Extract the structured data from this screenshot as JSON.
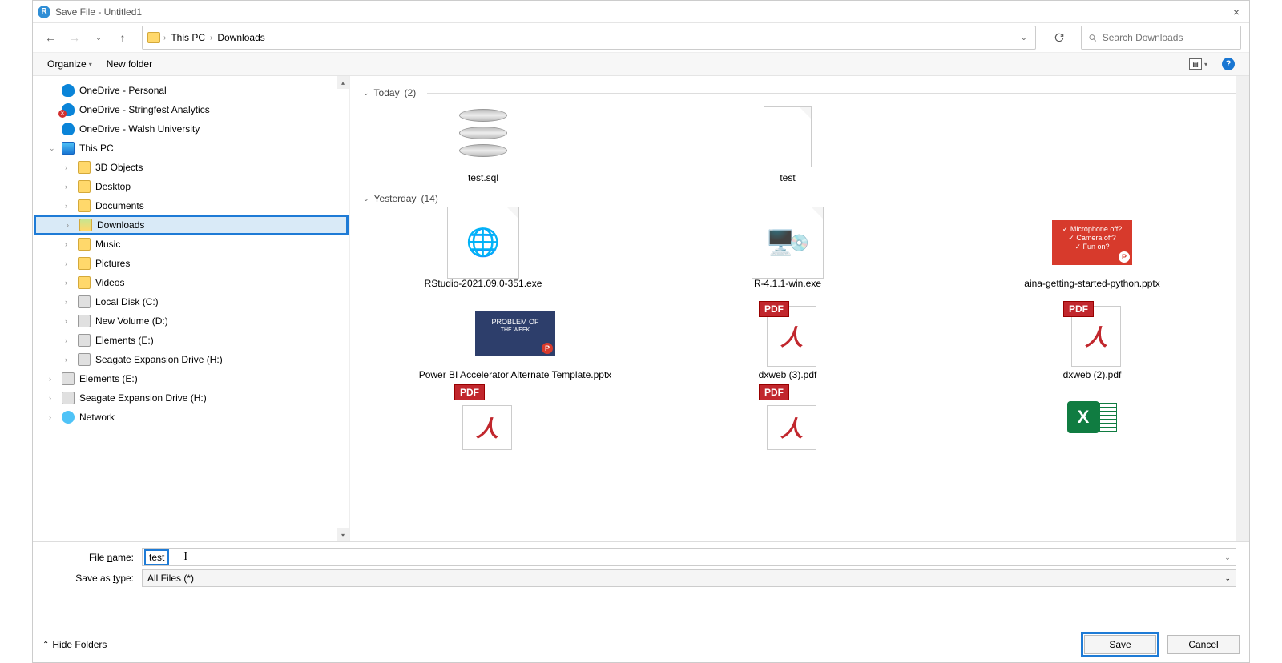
{
  "window": {
    "title": "Save File - Untitled1"
  },
  "nav": {
    "crumb1": "This PC",
    "crumb2": "Downloads",
    "search_placeholder": "Search Downloads"
  },
  "toolbar": {
    "organize": "Organize",
    "new_folder": "New folder"
  },
  "sidebar": {
    "items": [
      {
        "label": "OneDrive - Personal",
        "icon": "cloud",
        "chev": ""
      },
      {
        "label": "OneDrive - Stringfest Analytics",
        "icon": "cloud-err",
        "chev": ""
      },
      {
        "label": "OneDrive - Walsh University",
        "icon": "cloud",
        "chev": ""
      },
      {
        "label": "This PC",
        "icon": "pc",
        "chev": "v"
      },
      {
        "label": "3D Objects",
        "icon": "folder",
        "chev": ">",
        "indent": true
      },
      {
        "label": "Desktop",
        "icon": "folder",
        "chev": ">",
        "indent": true
      },
      {
        "label": "Documents",
        "icon": "folder",
        "chev": ">",
        "indent": true
      },
      {
        "label": "Downloads",
        "icon": "folder-dl",
        "chev": ">",
        "indent": true,
        "selected": true,
        "highlight": true
      },
      {
        "label": "Music",
        "icon": "folder",
        "chev": ">",
        "indent": true
      },
      {
        "label": "Pictures",
        "icon": "folder",
        "chev": ">",
        "indent": true
      },
      {
        "label": "Videos",
        "icon": "folder",
        "chev": ">",
        "indent": true
      },
      {
        "label": "Local Disk (C:)",
        "icon": "drive",
        "chev": ">",
        "indent": true
      },
      {
        "label": "New Volume (D:)",
        "icon": "drive",
        "chev": ">",
        "indent": true
      },
      {
        "label": "Elements (E:)",
        "icon": "drive",
        "chev": ">",
        "indent": true
      },
      {
        "label": "Seagate Expansion Drive (H:)",
        "icon": "drive",
        "chev": ">",
        "indent": true
      },
      {
        "label": "Elements (E:)",
        "icon": "drive",
        "chev": ">"
      },
      {
        "label": "Seagate Expansion Drive (H:)",
        "icon": "drive",
        "chev": ">"
      },
      {
        "label": "Network",
        "icon": "net",
        "chev": ">"
      }
    ]
  },
  "groups": {
    "today_label": "Today",
    "today_count": "(2)",
    "yesterday_label": "Yesterday",
    "yesterday_count": "(14)"
  },
  "files": {
    "today": [
      {
        "name": "test.sql",
        "type": "db"
      },
      {
        "name": "test",
        "type": "blank"
      }
    ],
    "yesterday_r1": [
      {
        "name": "RStudio-2021.09.0-351.exe",
        "type": "exe-globe"
      },
      {
        "name": "R-4.1.1-win.exe",
        "type": "exe-installer"
      },
      {
        "name": "aina-getting-started-python.pptx",
        "type": "pptx-red",
        "slide_l1": "✓ Microphone off?",
        "slide_l2": "✓ Camera off?",
        "slide_l3": "✓ Fun on?"
      }
    ],
    "yesterday_r2": [
      {
        "name": "Power BI Accelerator Alternate Template.pptx",
        "type": "pptx-blue",
        "slide_t": "PROBLEM OF",
        "slide_b": "THE WEEK"
      },
      {
        "name": "dxweb (3).pdf",
        "type": "pdf"
      },
      {
        "name": "dxweb (2).pdf",
        "type": "pdf"
      }
    ],
    "yesterday_r3": [
      {
        "name": "",
        "type": "pdf"
      },
      {
        "name": "",
        "type": "pdf"
      },
      {
        "name": "",
        "type": "xlsx"
      }
    ]
  },
  "lower": {
    "filename_label": "File name:",
    "filename_value": "test",
    "savetype_label": "Save as type:",
    "savetype_value": "All Files  (*)"
  },
  "buttons": {
    "hide_folders": "Hide Folders",
    "save": "Save",
    "cancel": "Cancel"
  }
}
